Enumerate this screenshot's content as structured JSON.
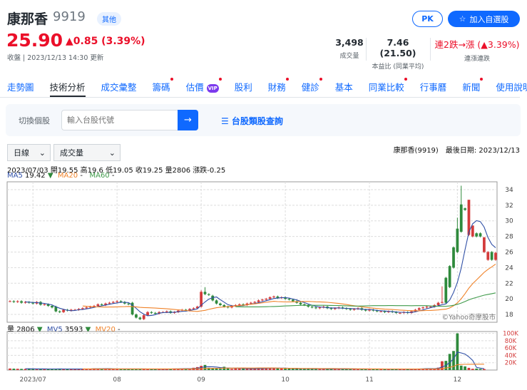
{
  "header": {
    "name": "康那香",
    "code": "9919",
    "badge": "其他",
    "price": "25.90",
    "change": "▲0.85 (3.39%)",
    "updated": "收盤 | 2023/12/13 14:30 更新",
    "pk": "PK",
    "watch": "加入自選股"
  },
  "stats": [
    {
      "value": "3,498",
      "label": "成交量"
    },
    {
      "value": "7.46 (21.50)",
      "label": "本益比 (同業平均)"
    },
    {
      "value": "連2跌→漲 (▲3.39%)",
      "label": "連漲連跌"
    }
  ],
  "nav": [
    {
      "label": "走勢圖"
    },
    {
      "label": "技術分析",
      "active": true
    },
    {
      "label": "成交彙整"
    },
    {
      "label": "籌碼",
      "dot": true
    },
    {
      "label": "估價",
      "vip": "VIP",
      "dot": true
    },
    {
      "label": "股利"
    },
    {
      "label": "財務",
      "dot": true
    },
    {
      "label": "健診",
      "dot": true
    },
    {
      "label": "基本"
    },
    {
      "label": "同業比較",
      "dot": true
    },
    {
      "label": "行事曆"
    },
    {
      "label": "新聞",
      "dot": true
    },
    {
      "label": "使用說明"
    }
  ],
  "search": {
    "label": "切換個股",
    "placeholder": "輸入台股代號",
    "go": "→",
    "category": "☰ 台股類股查詢"
  },
  "controls": {
    "period": "日線",
    "indicator": "成交量",
    "last_date": "康那香(9919)　最後日期: 2023/12/13"
  },
  "info": {
    "ohlc": "2023/07/03 開19.55 高19.6 低19.05 收19.25 量2806 漲跌-0.25",
    "ma5": "MA5",
    "ma5_val": "19.42",
    "ma20": "MA20",
    "ma20_val": "-",
    "ma60": "MA60",
    "ma60_val": "-",
    "arrow": "▼"
  },
  "vol_info": {
    "label": "量",
    "val": "2806",
    "mv5": "MV5",
    "mv5_val": "3593",
    "mv20": "MV20",
    "mv20_val": "-",
    "arrow": "▼"
  },
  "watermark": "©Yahoo奇摩股市",
  "colors": {
    "up": "#d33b3b",
    "down": "#2f8a3c",
    "ma5": "#2f4fa6",
    "ma20": "#f0832a",
    "ma60": "#3f9a4a",
    "accent": "#0f69ff"
  },
  "chart_data": {
    "type": "candlestick",
    "price_ylim": [
      17,
      35
    ],
    "price_ticks": [
      18,
      20,
      22,
      24,
      26,
      28,
      30,
      32,
      34
    ],
    "vol_ylim": [
      0,
      100000
    ],
    "vol_ticks": [
      "20K",
      "40K",
      "60K",
      "80K",
      "100K"
    ],
    "vol_tick_values": [
      20000,
      40000,
      60000,
      80000,
      100000
    ],
    "months": [
      {
        "label": "2023/07",
        "index": 6
      },
      {
        "label": "08",
        "index": 28
      },
      {
        "label": "09",
        "index": 50
      },
      {
        "label": "10",
        "index": 72
      },
      {
        "label": "11",
        "index": 94
      },
      {
        "label": "12",
        "index": 117
      }
    ],
    "close": [
      19.7,
      19.6,
      19.7,
      19.5,
      19.6,
      19.5,
      19.4,
      19.6,
      19.25,
      19.3,
      19.1,
      18.9,
      18.4,
      18.3,
      18.6,
      18.5,
      18.6,
      18.6,
      18.7,
      18.8,
      18.9,
      19.0,
      19.1,
      19.3,
      19.2,
      19.4,
      19.5,
      19.6,
      19.7,
      19.6,
      19.4,
      19.3,
      18.0,
      17.6,
      17.4,
      17.9,
      18.3,
      18.2,
      18.1,
      18.3,
      18.3,
      18.4,
      18.2,
      18.3,
      18.5,
      18.6,
      18.5,
      18.7,
      18.8,
      19.0,
      20.9,
      20.6,
      20.5,
      19.8,
      19.4,
      19.2,
      19.0,
      18.9,
      19.1,
      19.2,
      19.3,
      19.2,
      19.4,
      19.5,
      19.6,
      19.8,
      19.9,
      20.0,
      20.2,
      20.3,
      20.1,
      20.2,
      20.0,
      19.9,
      19.7,
      19.5,
      19.3,
      19.2,
      19.0,
      18.9,
      18.8,
      18.9,
      19.0,
      18.8,
      18.7,
      18.8,
      18.9,
      18.8,
      18.7,
      18.6,
      18.7,
      18.8,
      18.6,
      18.5,
      18.6,
      18.5,
      18.4,
      18.4,
      18.3,
      18.4,
      18.3,
      18.2,
      18.2,
      18.3,
      18.2,
      18.4,
      18.6,
      18.8,
      18.9,
      19.0,
      19.0,
      19.2,
      19.5,
      19.6,
      19.5,
      21.5,
      24.0,
      26.0,
      28.6,
      31.4,
      32.7,
      29.4,
      28.0,
      28.0,
      27.9,
      26.0,
      25.0,
      25.9
    ],
    "open": {
      "12": 19.0,
      "32": 19.5,
      "35": 17.4,
      "50": 19.0,
      "53": 20.4,
      "114": 22.7,
      "115": 24.2,
      "116": 26.6,
      "117": 29.0,
      "118": 32.1,
      "119": 31.6,
      "120": 28.2,
      "121": 28.0,
      "122": 28.4,
      "123": 28.4,
      "124": 26.0,
      "125": 25.0
    },
    "high": {
      "50": 21.1,
      "51": 21.5,
      "113": 21.6,
      "117": 30.4,
      "118": 34.5,
      "119": 31.7,
      "120": 29.0,
      "121": 28.8,
      "124": 26.2
    },
    "volume": [
      4200,
      3800,
      3500,
      3200,
      3000,
      3600,
      2900,
      3300,
      2806,
      3100,
      2700,
      2900,
      3500,
      3200,
      2600,
      2800,
      2500,
      2700,
      3000,
      3100,
      2900,
      3200,
      4400,
      3800,
      3300,
      3600,
      3100,
      2900,
      3000,
      3300,
      3100,
      2800,
      3500,
      3000,
      2700,
      3100,
      2600,
      2500,
      2700,
      2400,
      2600,
      2800,
      3900,
      4100,
      3500,
      3200,
      3600,
      4200,
      6200,
      8100,
      11500,
      14000,
      6200,
      4800,
      4300,
      3500,
      9000,
      5200,
      3100,
      4400,
      3800,
      4500,
      3200,
      3000,
      4200,
      5000,
      4500,
      5300,
      6100,
      5400,
      4800,
      5100,
      4600,
      3900,
      3700,
      3400,
      3000,
      4800,
      3600,
      3100,
      2800,
      3300,
      3700,
      3200,
      3000,
      3500,
      2900,
      3100,
      2700,
      3300,
      2900,
      2600,
      3000,
      2800,
      2700,
      3200,
      2900,
      2600,
      2500,
      2800,
      3000,
      2700,
      2500,
      2600,
      2400,
      2800,
      3200,
      4000,
      3800,
      4200,
      3900,
      3600,
      6500,
      24000,
      25000,
      44000,
      52000,
      100000,
      12000,
      10000,
      6000,
      3500,
      4000,
      3000,
      2806
    ]
  }
}
